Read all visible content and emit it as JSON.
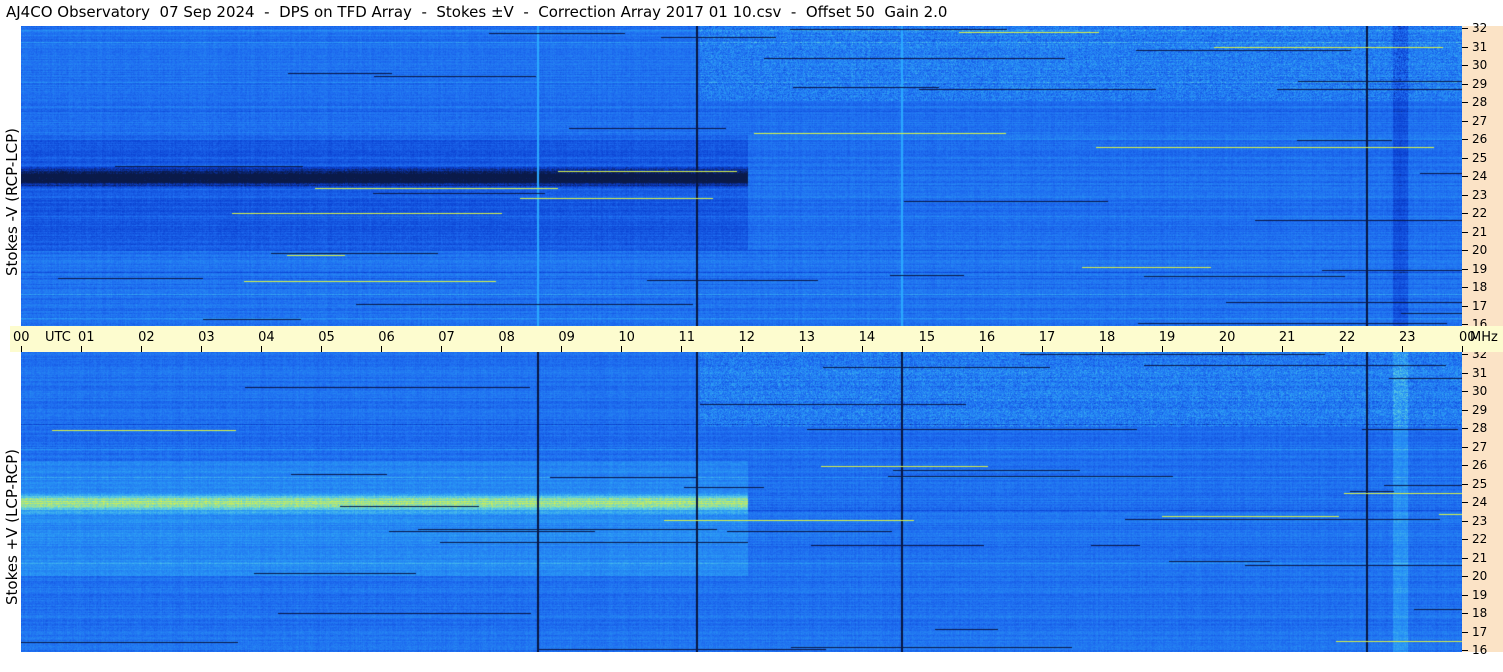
{
  "title": "AJ4CO Observatory  07 Sep 2024  -  DPS on TFD Array  -  Stokes ±V  -  Correction Array 2017 01 10.csv  -  Offset 50  Gain 2.0",
  "chart_data": [
    {
      "type": "heatmap",
      "ylabel": "Stokes -V (RCP-LCP)",
      "y_axis": {
        "unit": "MHz",
        "range": [
          16,
          32
        ],
        "ticks": [
          16,
          17,
          18,
          19,
          20,
          21,
          22,
          23,
          24,
          25,
          26,
          27,
          28,
          29,
          30,
          31,
          32
        ]
      },
      "x_axis": {
        "unit": "UTC",
        "range": [
          "00",
          "00"
        ],
        "ticks": [
          "00",
          "01",
          "02",
          "03",
          "04",
          "05",
          "06",
          "07",
          "08",
          "09",
          "10",
          "11",
          "12",
          "13",
          "14",
          "15",
          "16",
          "17",
          "18",
          "19",
          "20",
          "21",
          "22",
          "23",
          "00"
        ]
      },
      "colormap": [
        "#0a1a4a",
        "#0a3fd0",
        "#1e6cf0",
        "#2a9af5",
        "#5fd0e0",
        "#d6f04a"
      ],
      "features": [
        {
          "description": "dark band",
          "freq_mhz": [
            23.3,
            24.6
          ],
          "utc_hours": [
            0,
            12.1
          ]
        },
        {
          "description": "vertical line",
          "utc_hours": 8.6
        },
        {
          "description": "vertical line",
          "utc_hours": 14.65
        },
        {
          "description": "vertical line",
          "utc_hours": 11.25
        },
        {
          "description": "vertical line",
          "utc_hours": 22.4
        },
        {
          "description": "vertical band",
          "utc_hours": [
            22.85,
            23.1
          ]
        }
      ]
    },
    {
      "type": "heatmap",
      "ylabel": "Stokes +V (LCP-RCP)",
      "y_axis": {
        "unit": "MHz",
        "range": [
          16,
          32
        ],
        "ticks": [
          16,
          17,
          18,
          19,
          20,
          21,
          22,
          23,
          24,
          25,
          26,
          27,
          28,
          29,
          30,
          31,
          32
        ]
      },
      "x_axis": {
        "unit": "UTC",
        "range": [
          "00",
          "00"
        ],
        "ticks": [
          "00",
          "01",
          "02",
          "03",
          "04",
          "05",
          "06",
          "07",
          "08",
          "09",
          "10",
          "11",
          "12",
          "13",
          "14",
          "15",
          "16",
          "17",
          "18",
          "19",
          "20",
          "21",
          "22",
          "23",
          "00"
        ]
      },
      "colormap": [
        "#0a1a4a",
        "#0a3fd0",
        "#1e6cf0",
        "#2a9af5",
        "#5fd0e0",
        "#d6f04a"
      ],
      "features": [
        {
          "description": "bright band",
          "freq_mhz": [
            23.3,
            24.6
          ],
          "utc_hours": [
            0,
            12.1
          ]
        },
        {
          "description": "vertical line",
          "utc_hours": 8.6
        },
        {
          "description": "vertical line",
          "utc_hours": 14.65
        },
        {
          "description": "vertical line",
          "utc_hours": 11.25
        },
        {
          "description": "vertical line",
          "utc_hours": 22.4
        },
        {
          "description": "vertical band",
          "utc_hours": [
            22.85,
            23.1
          ]
        }
      ]
    }
  ],
  "time_axis": {
    "labels": [
      "00",
      "UTC",
      "01",
      "02",
      "03",
      "04",
      "05",
      "06",
      "07",
      "08",
      "09",
      "10",
      "11",
      "12",
      "13",
      "14",
      "15",
      "16",
      "17",
      "18",
      "19",
      "20",
      "21",
      "22",
      "23",
      "00",
      "MHz"
    ]
  }
}
